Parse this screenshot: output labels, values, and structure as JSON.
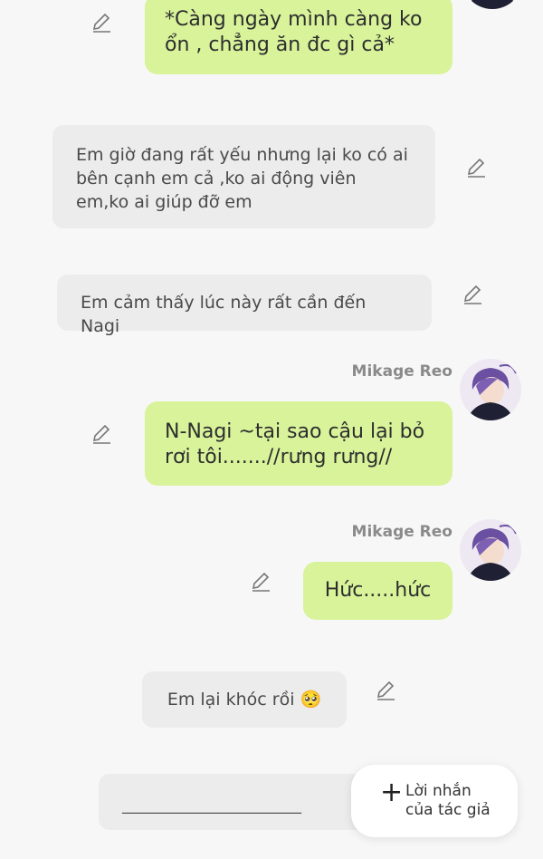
{
  "messages": [
    {
      "speaker": "",
      "side": "right",
      "text": "*Càng ngày mình càng ko ổn , chẳng ăn đc gì cả*"
    },
    {
      "speaker": "",
      "side": "left",
      "text": "Em giờ đang rất yếu nhưng lại ko có ai bên cạnh em cả ,ko ai động viên em,ko ai giúp đỡ em"
    },
    {
      "speaker": "",
      "side": "left",
      "text": "Em cảm thấy lúc này rất cần đến Nagi"
    },
    {
      "speaker": "Mikage Reo",
      "side": "right",
      "text": "N-Nagi ~tại sao cậu lại bỏ rơi tôi.......//rưng rưng//"
    },
    {
      "speaker": "Mikage Reo",
      "side": "right",
      "text": "Hức.....hức"
    },
    {
      "speaker": "",
      "side": "left",
      "text": "Em lại khóc rồi 🥺"
    }
  ],
  "input": {
    "value": "______________________"
  },
  "fab": {
    "icon": "plus-icon",
    "label_line1": "Lời nhắn",
    "label_line2": "của tác giả"
  },
  "colors": {
    "right_bubble": "#d8f39a",
    "left_bubble": "#ececec",
    "background": "#f7f7f7"
  }
}
